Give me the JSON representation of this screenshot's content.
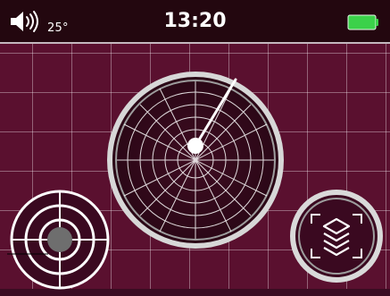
{
  "status": {
    "temperature": "25°",
    "time": "13:20",
    "battery_level": 1.0,
    "battery_color": "#3bd14a"
  },
  "colors": {
    "background": "#5a102f",
    "statusbar": "#23070f"
  },
  "icons": {
    "volume": "speaker-icon",
    "battery": "battery-icon",
    "radar": "radar-icon",
    "target": "target-icon",
    "layers": "layers-icon"
  }
}
